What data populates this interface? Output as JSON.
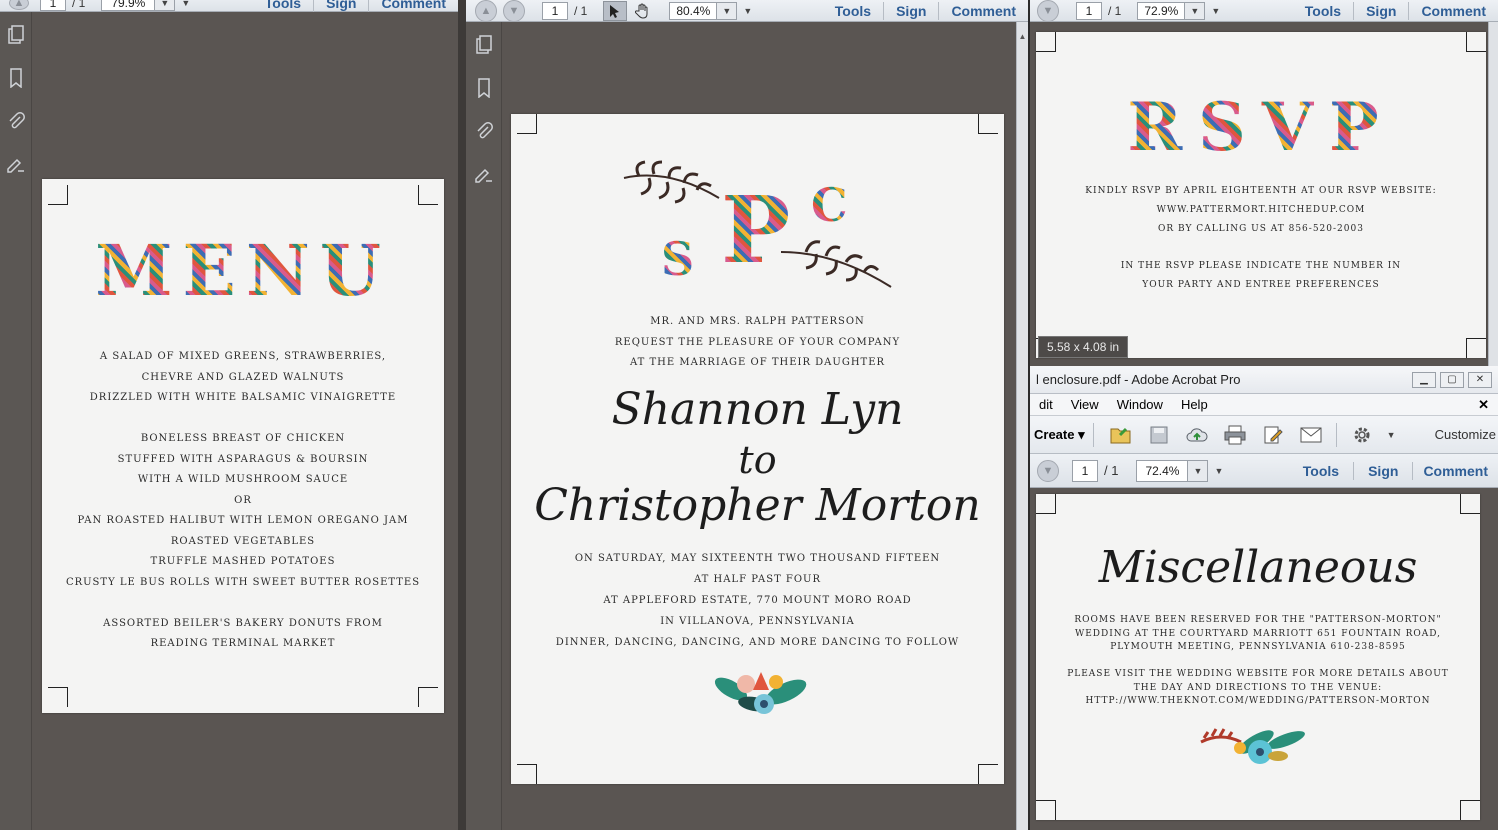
{
  "win1": {
    "page_input": "1",
    "page_total": "/ 1",
    "zoom": "79.9%",
    "tools": "Tools",
    "sign": "Sign",
    "comment": "Comment",
    "menu_title": "MENU",
    "menu_lines": [
      "A salad of mixed greens, strawberries,",
      "chevre and glazed walnuts",
      "drizzled with white balsamic vinaigrette",
      "",
      "Boneless breast of chicken",
      "stuffed with asparagus & boursin",
      "with a wild mushroom sauce",
      "or",
      "Pan roasted halibut with lemon oregano jam",
      "roasted vegetables",
      "truffle mashed potatoes",
      "crusty le bus rolls with sweet butter rosettes",
      "",
      "Assorted Beiler's Bakery donuts from",
      "Reading Terminal Market"
    ]
  },
  "win2": {
    "page_input": "1",
    "page_total": "/ 1",
    "zoom": "80.4%",
    "tools": "Tools",
    "sign": "Sign",
    "comment": "Comment",
    "monogram": {
      "left": "S",
      "center": "P",
      "right": "C"
    },
    "hosts": [
      "Mr. and Mrs. Ralph Patterson",
      "request the pleasure of your company",
      "at the marriage of their daughter"
    ],
    "bride": "Shannon Lyn",
    "to": "to",
    "groom": "Christopher Morton",
    "details": [
      "on Saturday, May sixteenth two thousand fifteen",
      "at half past four",
      "at Appleford Estate, 770 Mount Moro Road",
      "in Villanova, Pennsylvania",
      "dinner, dancing, dancing, and more dancing to follow"
    ]
  },
  "win3": {
    "page_input": "1",
    "page_total": "/ 1",
    "zoom": "72.9%",
    "tools": "Tools",
    "sign": "Sign",
    "comment": "Comment",
    "rsvp_title": "RSVP",
    "rsvp_lines": [
      "Kindly RSVP by April eighteenth at our RSVP website:",
      "www.pattermort.hitchedup.com",
      "or by calling us at 856-520-2003",
      "",
      "In the RSVP please indicate the number in",
      "your party and entree preferences"
    ],
    "size_badge": "5.58 x 4.08 in"
  },
  "win4": {
    "title": "l enclosure.pdf - Adobe Acrobat Pro",
    "menu": [
      "dit",
      "View",
      "Window",
      "Help"
    ],
    "create": "Create",
    "customize": "Customize",
    "page_input": "1",
    "page_total": "/ 1",
    "zoom": "72.4%",
    "tools": "Tools",
    "sign": "Sign",
    "comment": "Comment",
    "misc_title": "Miscellaneous",
    "misc_lines": [
      "Rooms have been reserved for the \"Patterson-Morton\"",
      "wedding at the Courtyard Marriott 651 Fountain Road,",
      "Plymouth Meeting, Pennsylvania 610-238-8595",
      "",
      "Please visit the wedding website for more details about",
      "the day and directions to the venue:",
      "http://www.theknot.com/wedding/patterson-morton"
    ]
  },
  "colors": {
    "link": "#2f5e96",
    "viewport": "#5a5552",
    "page": "#f4f4f3"
  }
}
